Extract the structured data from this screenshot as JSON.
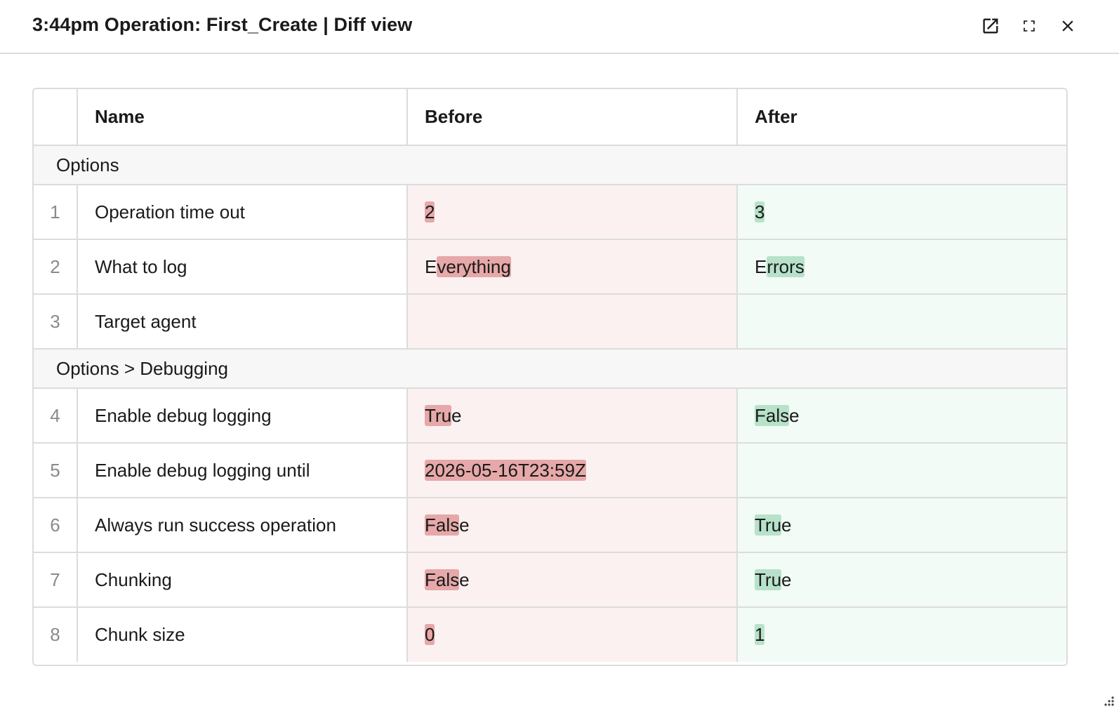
{
  "dialog": {
    "title": "3:44pm Operation: First_Create | Diff view",
    "icons": {
      "open_external": "open-in-new-icon",
      "fullscreen": "fullscreen-icon",
      "close": "close-icon",
      "resize": "resize-grip-icon"
    }
  },
  "table": {
    "headers": {
      "num": "",
      "name": "Name",
      "before": "Before",
      "after": "After"
    },
    "sections": [
      {
        "label": "Options",
        "rows": [
          {
            "num": "1",
            "name": "Operation time out",
            "before": [
              {
                "t": "2",
                "hl": true
              }
            ],
            "after": [
              {
                "t": "3",
                "hl": true
              }
            ]
          },
          {
            "num": "2",
            "name": "What to log",
            "before": [
              {
                "t": "E",
                "hl": false
              },
              {
                "t": "verything",
                "hl": true
              }
            ],
            "after": [
              {
                "t": "E",
                "hl": false
              },
              {
                "t": "rrors",
                "hl": true
              }
            ]
          },
          {
            "num": "3",
            "name": "Target agent",
            "before": [],
            "after": []
          }
        ]
      },
      {
        "label": "Options > Debugging",
        "rows": [
          {
            "num": "4",
            "name": "Enable debug logging",
            "before": [
              {
                "t": "Tru",
                "hl": true
              },
              {
                "t": "e",
                "hl": false
              }
            ],
            "after": [
              {
                "t": "Fals",
                "hl": true
              },
              {
                "t": "e",
                "hl": false
              }
            ]
          },
          {
            "num": "5",
            "name": "Enable debug logging until",
            "before": [
              {
                "t": "2026-05-16T23:59Z",
                "hl": true
              }
            ],
            "after": []
          },
          {
            "num": "6",
            "name": "Always run success operation",
            "before": [
              {
                "t": "Fals",
                "hl": true
              },
              {
                "t": "e",
                "hl": false
              }
            ],
            "after": [
              {
                "t": "Tru",
                "hl": true
              },
              {
                "t": "e",
                "hl": false
              }
            ]
          },
          {
            "num": "7",
            "name": "Chunking",
            "before": [
              {
                "t": "Fals",
                "hl": true
              },
              {
                "t": "e",
                "hl": false
              }
            ],
            "after": [
              {
                "t": "Tru",
                "hl": true
              },
              {
                "t": "e",
                "hl": false
              }
            ]
          },
          {
            "num": "8",
            "name": "Chunk size",
            "before": [
              {
                "t": "0",
                "hl": true
              }
            ],
            "after": [
              {
                "t": "1",
                "hl": true
              }
            ]
          }
        ]
      }
    ]
  },
  "colors": {
    "removed_cell_bg": "#fbf1f1",
    "added_cell_bg": "#f2fbf6",
    "removed_highlight": "#e6a8a8",
    "added_highlight": "#b7e2c9",
    "border": "#dcdcdc",
    "section_bg": "#f7f7f7"
  }
}
